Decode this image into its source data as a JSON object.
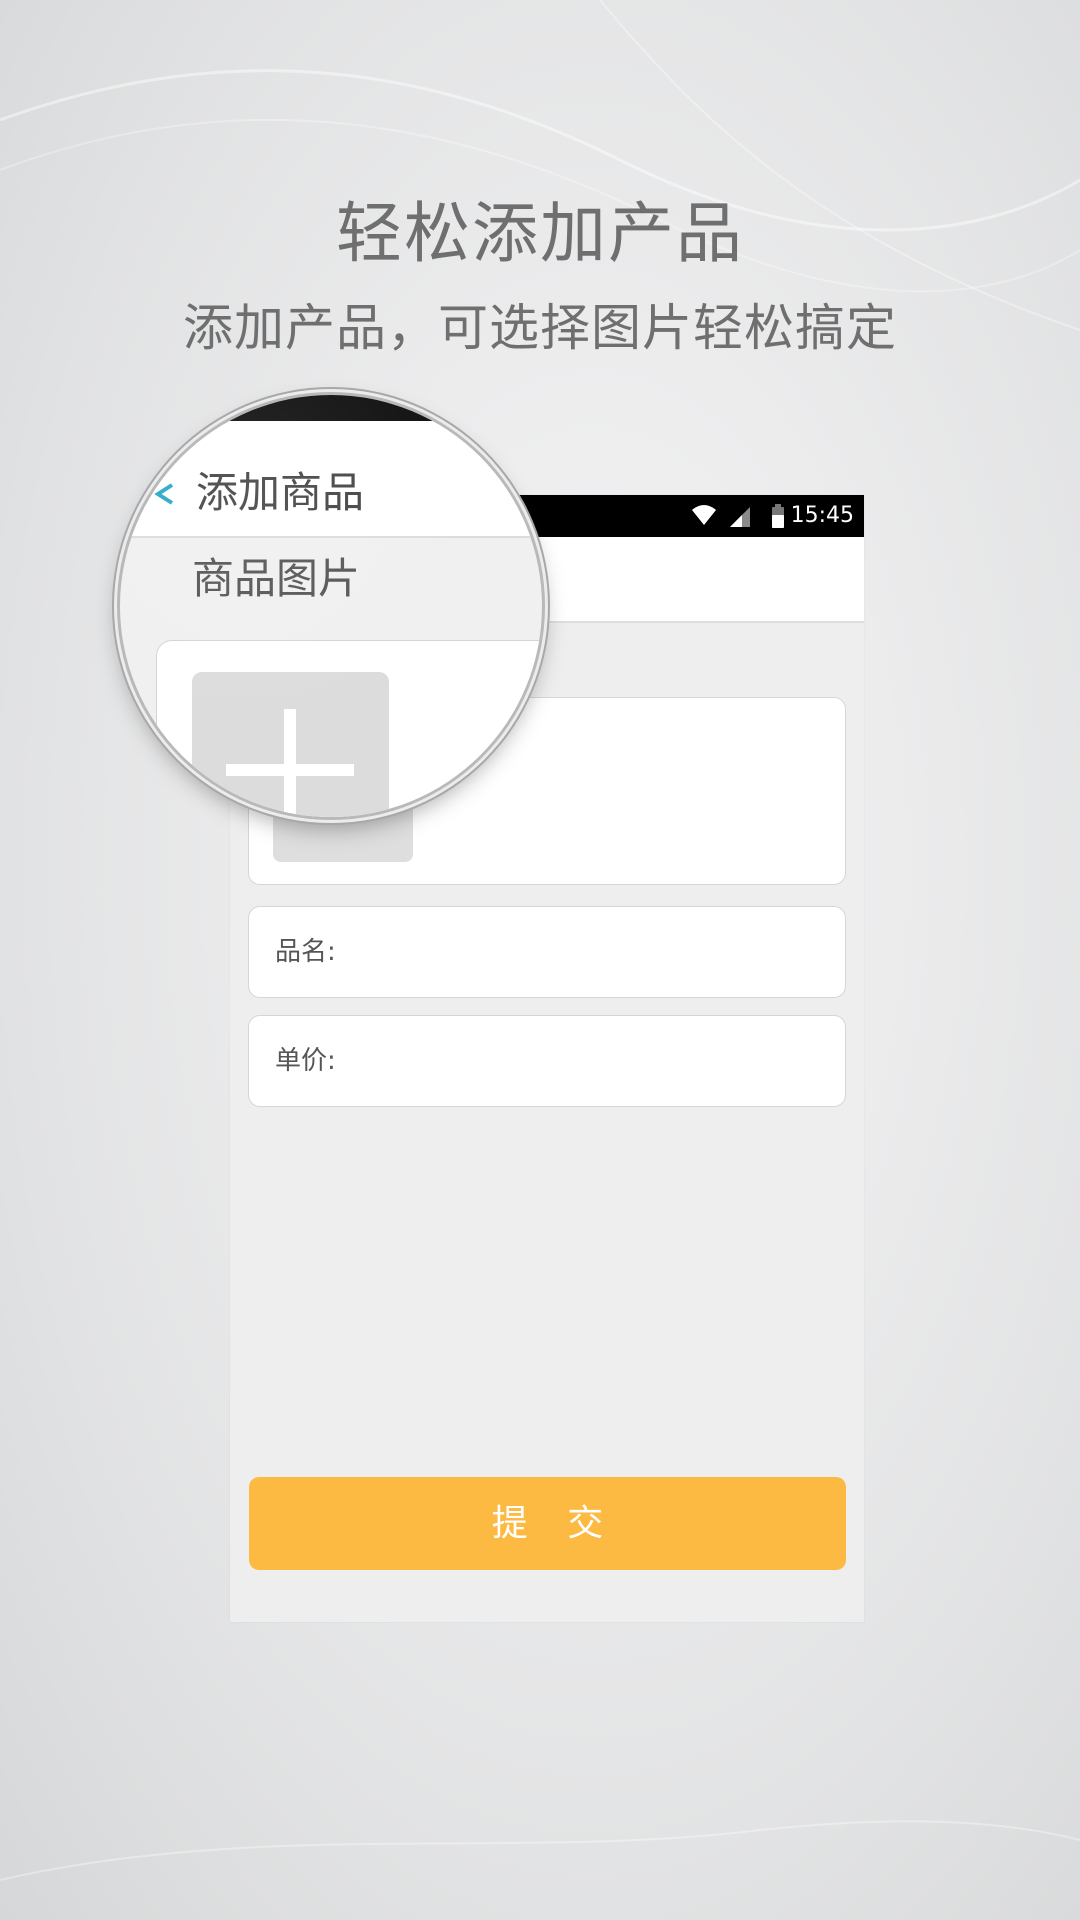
{
  "promo": {
    "title": "轻松添加产品",
    "subtitle": "添加产品，可选择图片轻松搞定"
  },
  "status_bar": {
    "time": "15:45",
    "icons": [
      "wifi-icon",
      "signal-icon",
      "battery-icon"
    ]
  },
  "magnifier": {
    "page_title": "添加商品",
    "section_label": "商品图片",
    "back_icon": "chevron-left-icon",
    "add_icon": "plus-icon"
  },
  "form": {
    "image_card": {
      "add_icon": "plus-icon"
    },
    "fields": {
      "name_label": "品名:",
      "price_label": "单价:"
    },
    "submit_label": "提 交"
  },
  "colors": {
    "accent_button": "#fdba43",
    "back_icon": "#29a8c8",
    "headline_text": "#6f6f6f",
    "screen_background": "#eeeeef"
  }
}
